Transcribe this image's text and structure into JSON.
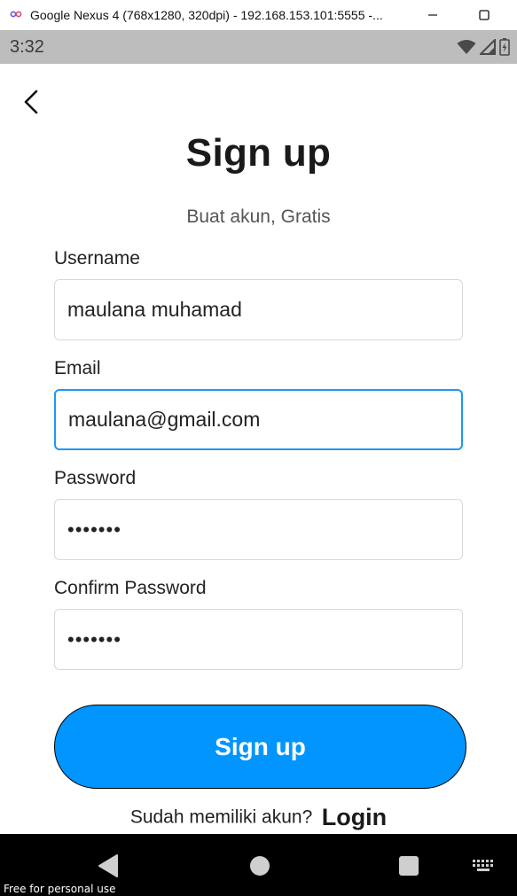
{
  "window": {
    "title": "Google Nexus 4 (768x1280, 320dpi) - 192.168.153.101:5555 -..."
  },
  "status_bar": {
    "time": "3:32"
  },
  "page": {
    "title": "Sign up",
    "subtitle": "Buat akun, Gratis"
  },
  "form": {
    "username": {
      "label": "Username",
      "value": "maulana muhamad"
    },
    "email": {
      "label": "Email",
      "value": "maulana@gmail.com"
    },
    "password": {
      "label": "Password",
      "value": "•••••••"
    },
    "confirm_password": {
      "label": "Confirm Password",
      "value": "•••••••"
    },
    "submit_label": "Sign up"
  },
  "footer": {
    "question": "Sudah memiliki akun?",
    "login_label": "Login"
  },
  "watermark": "Free for personal use",
  "colors": {
    "accent": "#0095ff",
    "focus_border": "#2196f3",
    "status_bar": "#bdbdbd",
    "nav_bar": "#000000"
  },
  "icons": {
    "app": "infinity-icon",
    "back": "chevron-left-icon",
    "wifi": "wifi-icon",
    "signal": "cell-signal-icon",
    "battery": "battery-charging-icon",
    "nav_back": "triangle-back-icon",
    "nav_home": "circle-home-icon",
    "nav_recents": "square-recents-icon",
    "keyboard": "keyboard-icon"
  }
}
